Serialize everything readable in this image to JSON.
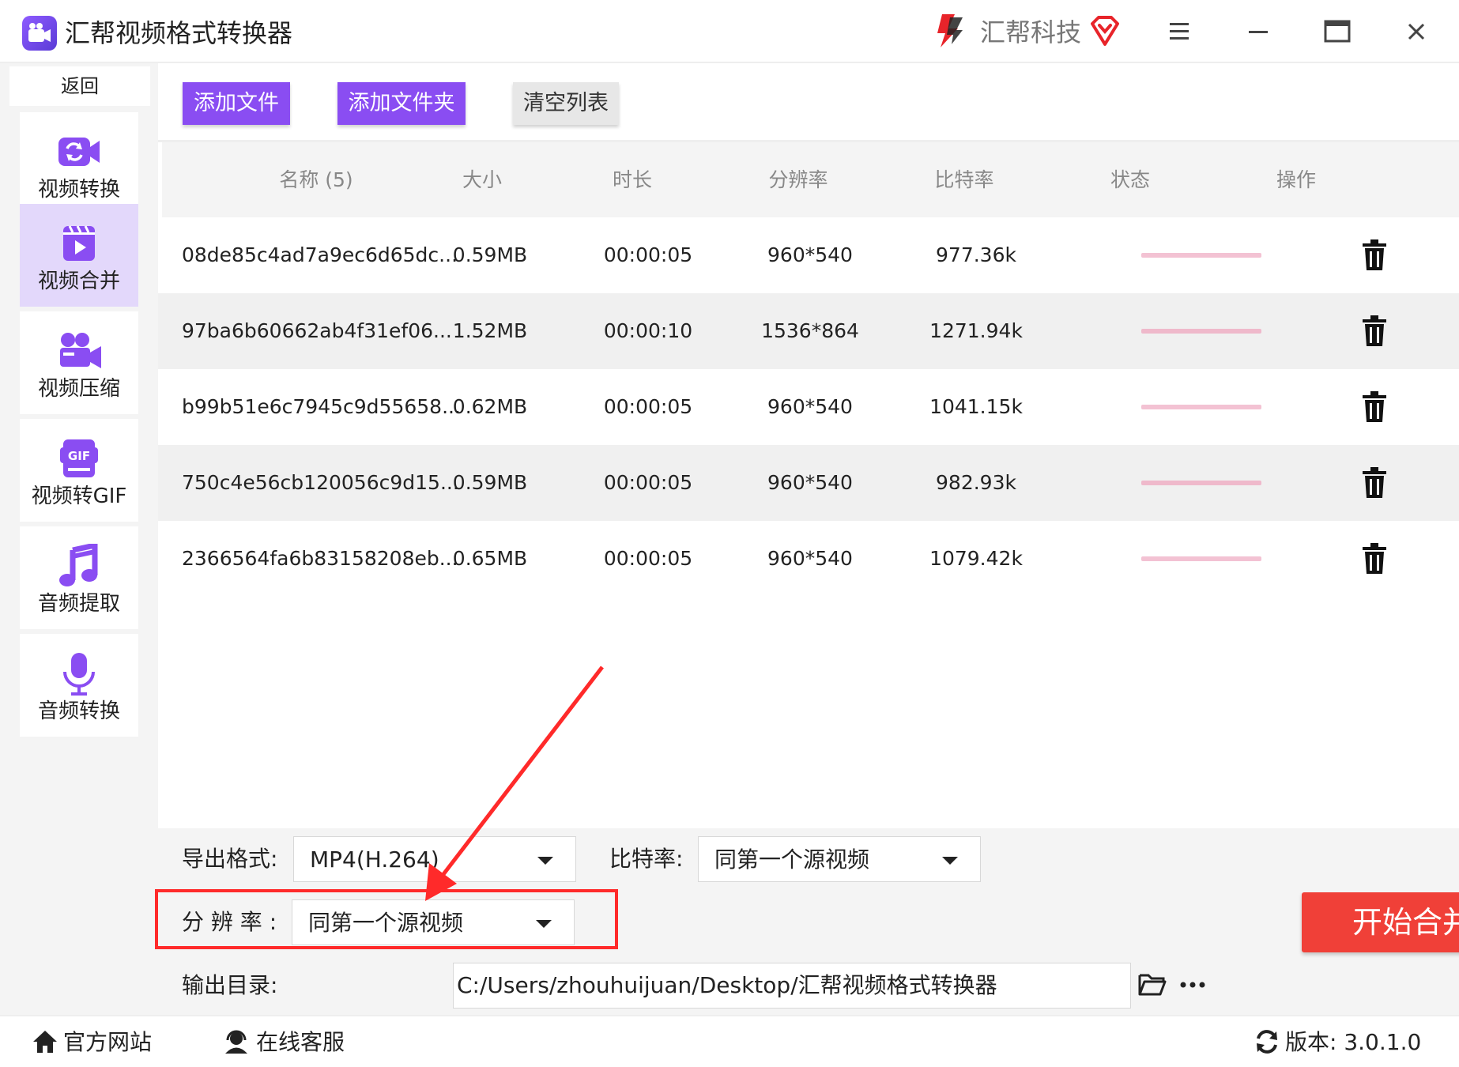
{
  "window": {
    "title": "汇帮视频格式转换器",
    "brand": "汇帮科技"
  },
  "sidebar": {
    "back_label": "返回",
    "items": [
      {
        "label": "视频转换",
        "icon": "video-convert-icon"
      },
      {
        "label": "视频合并",
        "icon": "video-merge-icon",
        "active": true
      },
      {
        "label": "视频压缩",
        "icon": "video-camera-icon"
      },
      {
        "label": "视频转GIF",
        "icon": "gif-icon"
      },
      {
        "label": "音频提取",
        "icon": "music-note-icon"
      },
      {
        "label": "音频转换",
        "icon": "microphone-icon"
      }
    ]
  },
  "toolbar": {
    "add_file": "添加文件",
    "add_folder": "添加文件夹",
    "clear_list": "清空列表"
  },
  "table": {
    "headers": {
      "name": "名称 (5)",
      "size": "大小",
      "duration": "时长",
      "resolution": "分辨率",
      "bitrate": "比特率",
      "status": "状态",
      "action": "操作"
    },
    "rows": [
      {
        "name": "08de85c4ad7a9ec6d65dc...",
        "size": "0.59MB",
        "duration": "00:00:05",
        "resolution": "960*540",
        "bitrate": "977.36k"
      },
      {
        "name": "97ba6b60662ab4f31ef06...",
        "size": "1.52MB",
        "duration": "00:00:10",
        "resolution": "1536*864",
        "bitrate": "1271.94k"
      },
      {
        "name": "b99b51e6c7945c9d55658...",
        "size": "0.62MB",
        "duration": "00:00:05",
        "resolution": "960*540",
        "bitrate": "1041.15k"
      },
      {
        "name": "750c4e56cb120056c9d15...",
        "size": "0.59MB",
        "duration": "00:00:05",
        "resolution": "960*540",
        "bitrate": "982.93k"
      },
      {
        "name": "2366564fa6b83158208eb...",
        "size": "0.65MB",
        "duration": "00:00:05",
        "resolution": "960*540",
        "bitrate": "1079.42k"
      }
    ]
  },
  "settings": {
    "format_label": "导出格式:",
    "format_value": "MP4(H.264)",
    "bitrate_label": "比特率:",
    "bitrate_value": "同第一个源视频",
    "resolution_label": "分 辨 率 :",
    "resolution_value": "同第一个源视频",
    "output_label": "输出目录:",
    "output_path": "C:/Users/zhouhuijuan/Desktop/汇帮视频格式转换器",
    "start_button": "开始合并"
  },
  "footer": {
    "website": "官方网站",
    "support": "在线客服",
    "version": "版本: 3.0.1.0"
  },
  "colors": {
    "accent": "#8a4df2",
    "start_button": "#f04038",
    "annotation": "#ff2a2a",
    "status_bar": "#f3c2d3"
  }
}
